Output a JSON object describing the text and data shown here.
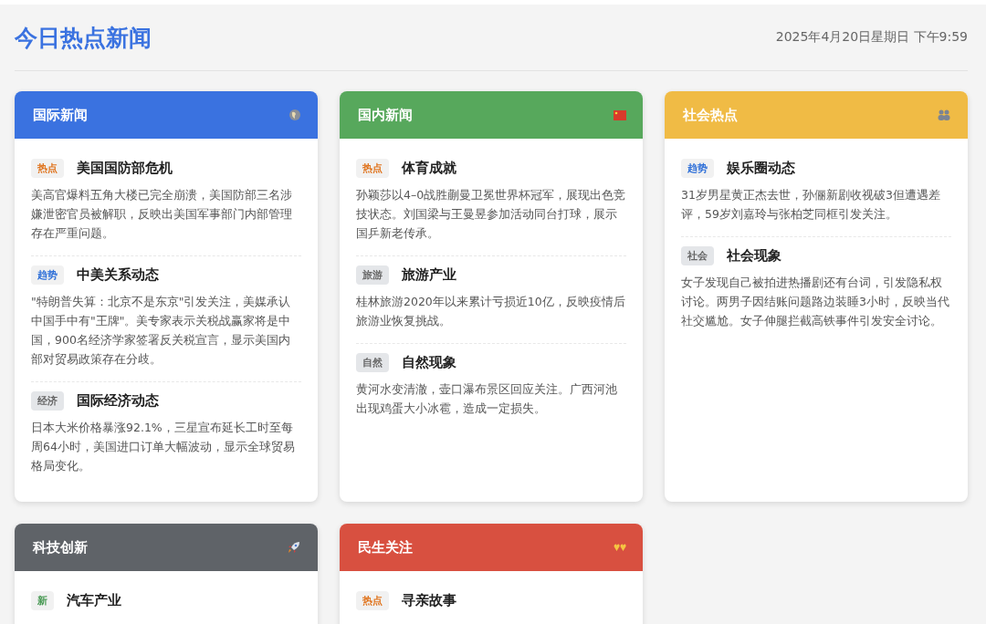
{
  "header": {
    "title": "今日热点新闻",
    "datetime": "2025年4月20日星期日 下午9:59"
  },
  "cards": [
    {
      "title": "国际新闻",
      "color": "#3a72e0",
      "items": [
        {
          "tag": "热点",
          "kind": "hot",
          "title": "美国国防部危机",
          "text": "美高官爆料五角大楼已完全崩溃，美国防部三名涉嫌泄密官员被解职，反映出美国军事部门内部管理存在严重问题。"
        },
        {
          "tag": "趋势",
          "kind": "trend",
          "title": "中美关系动态",
          "text": "\"特朗普失算：北京不是东京\"引发关注，美媒承认中国手中有\"王牌\"。美专家表示关税战赢家将是中国，900名经济学家签署反关税宣言，显示美国内部对贸易政策存在分歧。"
        },
        {
          "tag": "经济",
          "kind": "plain",
          "title": "国际经济动态",
          "text": "日本大米价格暴涨92.1%，三星宣布延长工时至每周64小时，美国进口订单大幅波动，显示全球贸易格局变化。"
        }
      ]
    },
    {
      "title": "国内新闻",
      "color": "#57a85c",
      "items": [
        {
          "tag": "热点",
          "kind": "hot",
          "title": "体育成就",
          "text": "孙颖莎以4–0战胜蒯曼卫冕世界杯冠军，展现出色竞技状态。刘国梁与王曼昱参加活动同台打球，展示国乒新老传承。"
        },
        {
          "tag": "旅游",
          "kind": "plain",
          "title": "旅游产业",
          "text": "桂林旅游2020年以来累计亏损近10亿，反映疫情后旅游业恢复挑战。"
        },
        {
          "tag": "自然",
          "kind": "plain",
          "title": "自然现象",
          "text": "黄河水变清澈，壶口瀑布景区回应关注。广西河池出现鸡蛋大小冰雹，造成一定损失。"
        }
      ]
    },
    {
      "title": "社会热点",
      "color": "#f0bb45",
      "items": [
        {
          "tag": "趋势",
          "kind": "trend",
          "title": "娱乐圈动态",
          "text": "31岁男星黄正杰去世，孙俪新剧收视破3但遭遇差评，59岁刘嘉玲与张柏芝同框引发关注。"
        },
        {
          "tag": "社会",
          "kind": "plain",
          "title": "社会现象",
          "text": "女子发现自己被拍进热播剧还有台词，引发隐私权讨论。两男子因结账问题路边装睡3小时，反映当代社交尴尬。女子伸腿拦截高铁事件引发安全讨论。"
        }
      ]
    },
    {
      "title": "科技创新",
      "color": "#5f6368",
      "items": [
        {
          "tag": "新",
          "kind": "new",
          "title": "汽车产业"
        }
      ]
    },
    {
      "title": "民生关注",
      "color": "#d85040",
      "items": [
        {
          "tag": "热点",
          "kind": "hot",
          "title": "寻亲故事"
        }
      ]
    }
  ]
}
